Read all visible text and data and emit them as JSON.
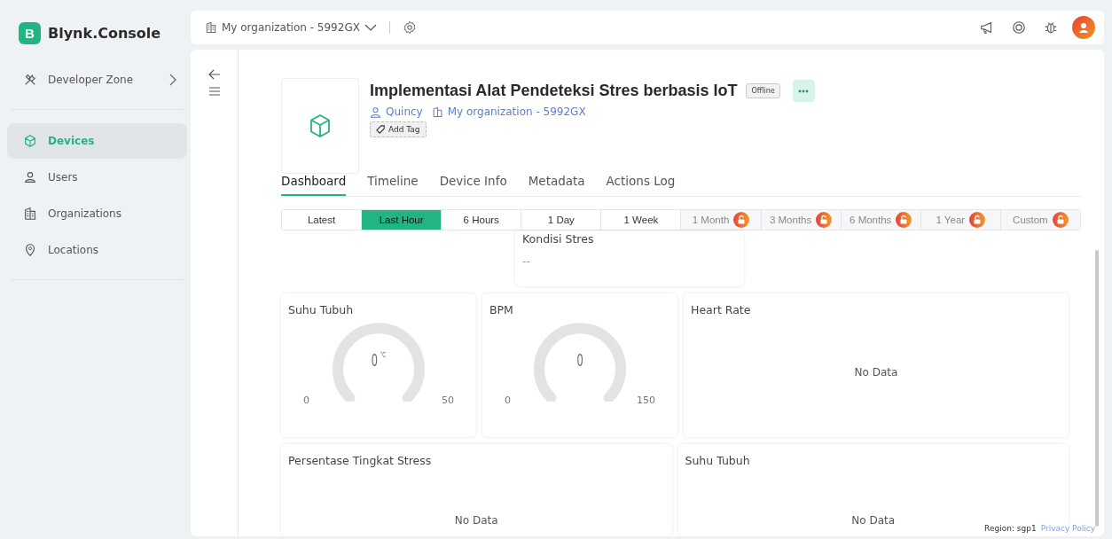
{
  "sidebar": {
    "logo_letter": "B",
    "brand": "Blynk.Console",
    "items": [
      {
        "label": "Developer Zone",
        "kind": "expand",
        "selected": false
      },
      {
        "label": "Devices",
        "kind": "item",
        "selected": true
      },
      {
        "label": "Users",
        "kind": "item",
        "selected": false
      },
      {
        "label": "Organizations",
        "kind": "item",
        "selected": false
      },
      {
        "label": "Locations",
        "kind": "item",
        "selected": false
      }
    ]
  },
  "topbar": {
    "organization": "My organization - 5992GX"
  },
  "device": {
    "title": "Implementasi Alat Pendeteksi Stres berbasis IoT",
    "status": "Offline",
    "owner": "Quincy",
    "organization": "My organization - 5992GX",
    "add_tag": "Add Tag"
  },
  "tabs": [
    {
      "label": "Dashboard",
      "selected": true
    },
    {
      "label": "Timeline",
      "selected": false
    },
    {
      "label": "Device Info",
      "selected": false
    },
    {
      "label": "Metadata",
      "selected": false
    },
    {
      "label": "Actions Log",
      "selected": false
    }
  ],
  "time_ranges": [
    {
      "label": "Latest",
      "selected": false,
      "locked": false
    },
    {
      "label": "Last Hour",
      "selected": true,
      "locked": false
    },
    {
      "label": "6 Hours",
      "selected": false,
      "locked": false
    },
    {
      "label": "1 Day",
      "selected": false,
      "locked": false
    },
    {
      "label": "1 Week",
      "selected": false,
      "locked": false
    },
    {
      "label": "1 Month",
      "selected": false,
      "locked": true
    },
    {
      "label": "3 Months",
      "selected": false,
      "locked": true
    },
    {
      "label": "6 Months",
      "selected": false,
      "locked": true
    },
    {
      "label": "1 Year",
      "selected": false,
      "locked": true
    },
    {
      "label": "Custom",
      "selected": false,
      "locked": true
    }
  ],
  "widgets": [
    {
      "kind": "label",
      "title": "Kondisi Stres",
      "value": "--"
    },
    {
      "kind": "gauge",
      "title": "Suhu Tubuh",
      "value": "0",
      "unit": "°C",
      "min": "0",
      "max": "50"
    },
    {
      "kind": "gauge",
      "title": "BPM",
      "value": "0",
      "min": "0",
      "max": "150"
    },
    {
      "kind": "chart",
      "title": "Heart Rate",
      "message": "No Data"
    },
    {
      "kind": "chart",
      "title": "Persentase Tingkat Stress",
      "message": "No Data"
    },
    {
      "kind": "chart",
      "title": "Suhu Tubuh",
      "message": "No Data"
    }
  ],
  "footer": {
    "region": "Region: sgp1",
    "privacy": "Privacy Policy"
  }
}
